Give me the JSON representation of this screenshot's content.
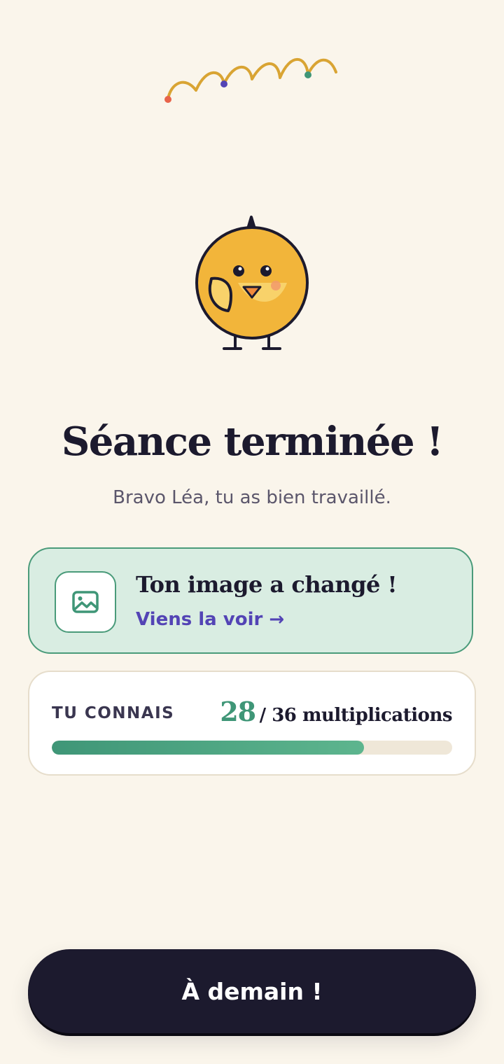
{
  "celebration": {
    "title": "Séance terminée !",
    "subtitle": "Bravo Léa, tu as bien travaillé."
  },
  "image_card": {
    "icon": "image-icon",
    "title": "Ton image a changé !",
    "link_label": "Viens la voir →"
  },
  "progress": {
    "label": "TU CONNAIS",
    "known": "28",
    "total_text": "/ 36 multiplications",
    "fraction": 0.78
  },
  "cta": {
    "label": "À demain !"
  },
  "colors": {
    "background": "#FAF5EB",
    "ink": "#1C1A2E",
    "accent_green": "#3F9677",
    "accent_purple": "#5344B5",
    "mascot_yellow": "#F2B53A"
  }
}
